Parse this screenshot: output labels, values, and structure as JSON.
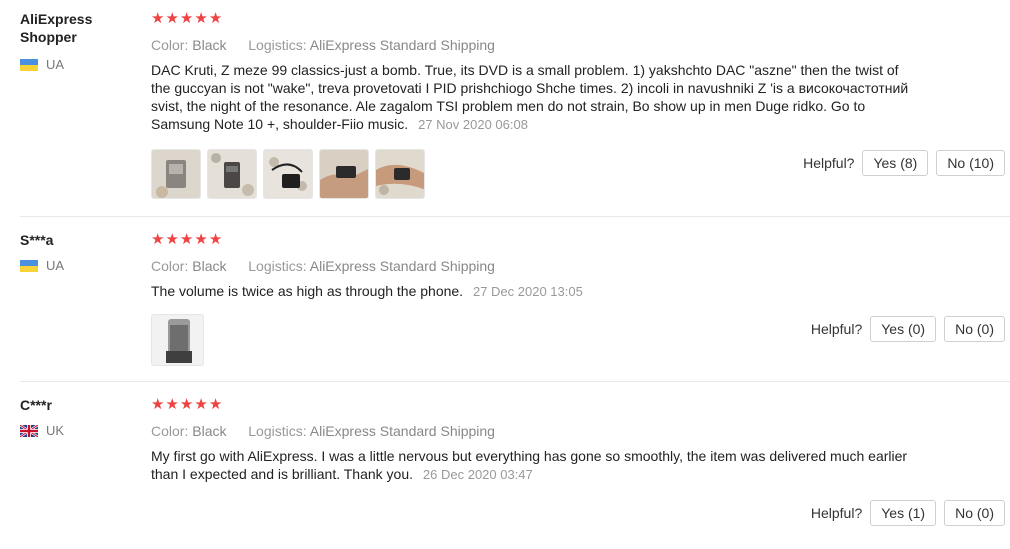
{
  "reviews": [
    {
      "user": "AliExpress\nShopper",
      "country": "UA",
      "flag": "ukraine-flag",
      "rating": 5,
      "color_label": "Color:",
      "color_value": "Black",
      "logistics_label": "Logistics:",
      "logistics_value": "AliExpress Standard Shipping",
      "text": "DAC Kruti, Z meze 99 classics-just a bomb. True, its DVD is a small problem. 1) yakshchto DAC \"aszne\" then the twist of the guccyan is not \"wake\", treva provetovati I PID prishchiogo Shche times. 2) incoli in navushniki Z 'is a високочастотний svist, the night of the resonance. Ale zagalom TSI problem men do not strain, Bo show up in men Duge ridko. Go to Samsung Note 10 +, shoulder-Fiio music.",
      "date": "27 Nov 2020 06:08",
      "photo_count": 5,
      "helpful_label": "Helpful?",
      "yes_label": "Yes (8)",
      "no_label": "No (10)"
    },
    {
      "user": "S***a",
      "country": "UA",
      "flag": "ukraine-flag",
      "rating": 5,
      "color_label": "Color:",
      "color_value": "Black",
      "logistics_label": "Logistics:",
      "logistics_value": "AliExpress Standard Shipping",
      "text": "The volume is twice as high as through the phone.",
      "date": "27 Dec 2020 13:05",
      "photo_count": 1,
      "helpful_label": "Helpful?",
      "yes_label": "Yes (0)",
      "no_label": "No (0)"
    },
    {
      "user": "C***r",
      "country": "UK",
      "flag": "uk-flag",
      "rating": 5,
      "color_label": "Color:",
      "color_value": "Black",
      "logistics_label": "Logistics:",
      "logistics_value": "AliExpress Standard Shipping",
      "text": "My first go with AliExpress. I was a little nervous but everything has gone so smoothly, the item was delivered much earlier than I expected and is brilliant. Thank you.",
      "date": "26 Dec 2020 03:47",
      "photo_count": 0,
      "helpful_label": "Helpful?",
      "yes_label": "Yes (1)",
      "no_label": "No (0)"
    }
  ],
  "colors": {
    "star": "#ef4242",
    "divider": "#e8e8e8"
  },
  "icons": {
    "star": "star-icon"
  }
}
